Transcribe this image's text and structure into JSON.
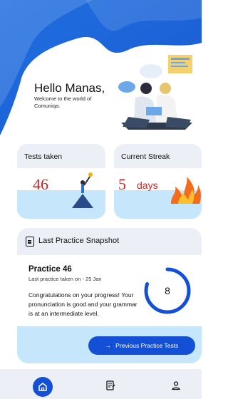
{
  "header": {
    "greeting": "Hello Manas,",
    "welcome": "Welcome to the world of Comuniqa."
  },
  "tests_card": {
    "title": "Tests taken",
    "value": "46"
  },
  "streak_card": {
    "title": "Current Streak",
    "value": "5",
    "unit": "days"
  },
  "snapshot": {
    "title": "Last Practice Snapshot",
    "practice_name": "Practice 46",
    "date": "Last practice taken on - 25 Jan",
    "message": "Congratulations on your progress! Your pronunciation is good and your grammar is at an intermediate level.",
    "score": "8",
    "score_fraction": 0.8,
    "button_label": "Previous Practice Tests",
    "button_icon": "arrow-right-icon"
  },
  "nav": {
    "items": [
      {
        "icon": "home-icon",
        "active": true
      },
      {
        "icon": "notes-icon",
        "active": false
      },
      {
        "icon": "profile-icon",
        "active": false
      }
    ]
  },
  "colors": {
    "primary": "#1350d6",
    "accent_red": "#c62828",
    "light_blue": "#c6e7fb",
    "card_grey": "#eceff5"
  }
}
